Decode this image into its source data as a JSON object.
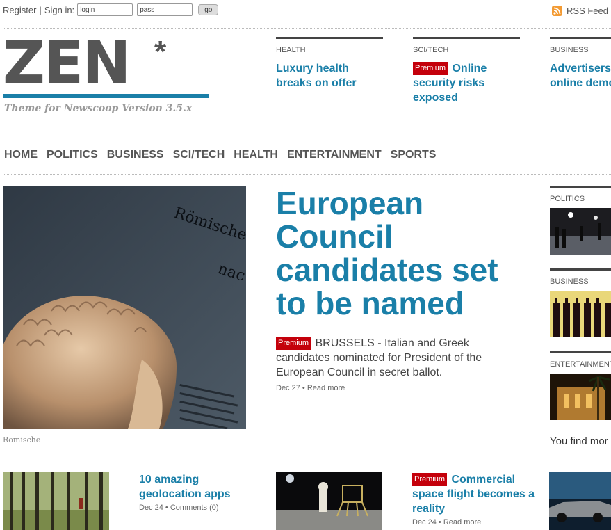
{
  "topbar": {
    "register": "Register",
    "separator": "|",
    "signin": "Sign in:",
    "login_value": "login",
    "pass_value": "pass",
    "go": "go",
    "rss": "RSS Feed"
  },
  "logo": {
    "text": "ZEN",
    "star": "*",
    "tagline": "Theme for Newscoop Version 3.5.x"
  },
  "header_articles": [
    {
      "section": "HEALTH",
      "title": "Luxury health breaks on offer",
      "premium": ""
    },
    {
      "section": "SCI/TECH",
      "title": "Online security risks exposed",
      "premium": "Premium"
    },
    {
      "section": "BUSINESS",
      "title": "Advertisers online demo",
      "premium": ""
    }
  ],
  "nav": [
    "HOME",
    "POLITICS",
    "BUSINESS",
    "SCI/TECH",
    "HEALTH",
    "ENTERTAINMENT",
    "SPORTS"
  ],
  "main": {
    "image_caption": "Romische",
    "image_text": [
      "Römische",
      "nac"
    ],
    "title": "European Council candidates set to be named",
    "premium": "Premium",
    "lede": "BRUSSELS - Italian and Greek candidates nominated for President of the European Council in secret ballot.",
    "date": "Dec 27",
    "bullet": "•",
    "read_more": "Read more"
  },
  "sidebar": {
    "sections": [
      "POLITICS",
      "BUSINESS",
      "ENTERTAINMENT"
    ],
    "more": "You find mor"
  },
  "bottom": [
    {
      "title": "10 amazing geolocation apps",
      "premium": "",
      "date": "Dec 24",
      "bullet": "•",
      "link": "Comments (0)"
    },
    {
      "title": "Commercial space flight becomes a reality",
      "premium": "Premium",
      "date": "Dec 24",
      "bullet": "•",
      "link": "Read more"
    }
  ],
  "colors": {
    "accent": "#1a7fa8",
    "premium": "#c4000b",
    "logo": "#555555"
  }
}
